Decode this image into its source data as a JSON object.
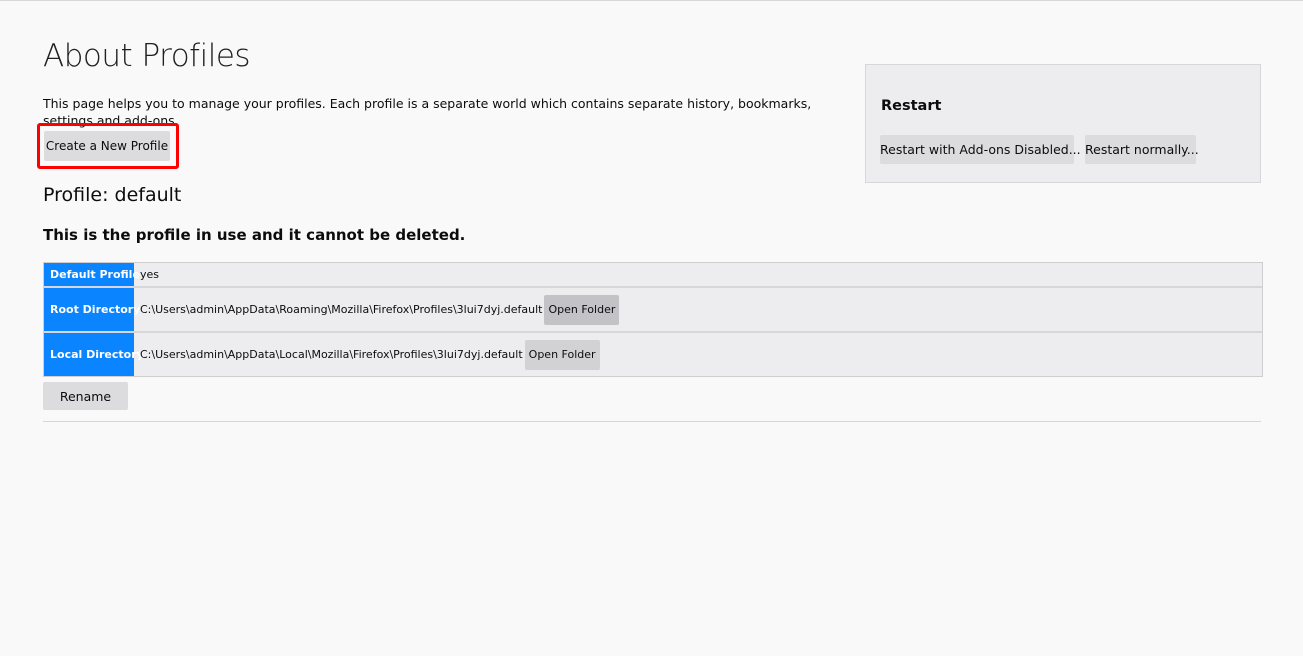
{
  "page": {
    "title": "About Profiles",
    "intro": "This page helps you to manage your profiles. Each profile is a separate world which contains separate history, bookmarks, settings and add-ons.",
    "create_button": "Create a New Profile"
  },
  "restart": {
    "title": "Restart",
    "safe_mode_button": "Restart with Add-ons Disabled...",
    "normal_button": "Restart normally..."
  },
  "profile": {
    "heading": "Profile: default",
    "in_use_note": "This is the profile in use and it cannot be deleted.",
    "rows": [
      {
        "label": "Default Profile",
        "value": "yes"
      },
      {
        "label": "Root Directory",
        "value": "C:\\Users\\admin\\AppData\\Roaming\\Mozilla\\Firefox\\Profiles\\3lui7dyj.default",
        "button": "Open Folder"
      },
      {
        "label": "Local Directory",
        "value": "C:\\Users\\admin\\AppData\\Local\\Mozilla\\Firefox\\Profiles\\3lui7dyj.default",
        "button": "Open Folder"
      }
    ],
    "rename_button": "Rename"
  },
  "colors": {
    "accent": "#0a84ff",
    "highlight": "#ff0000",
    "background": "#f9f9fa"
  }
}
